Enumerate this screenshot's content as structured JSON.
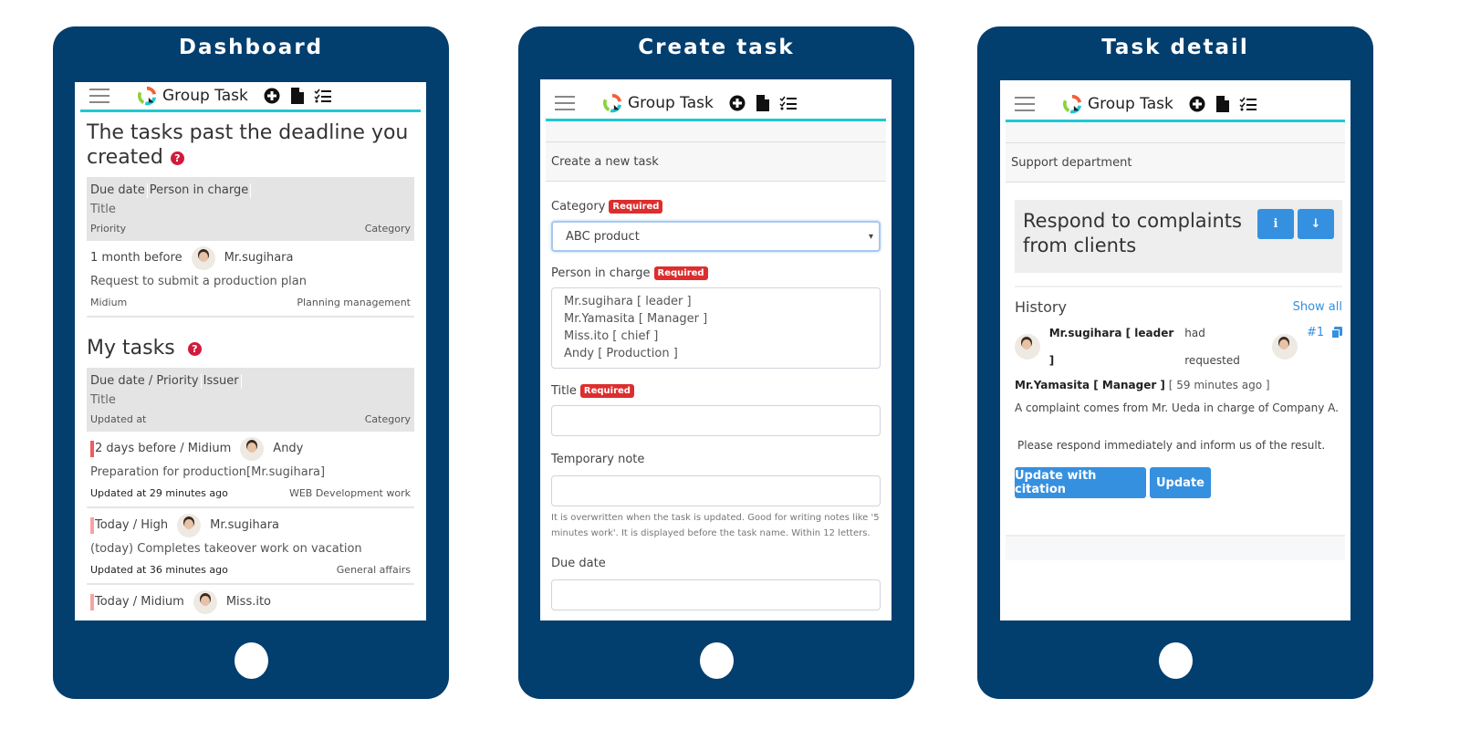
{
  "app": {
    "brand": "Group Task",
    "icons": [
      "menu-icon",
      "logo-icon",
      "plus-circle-icon",
      "file-icon",
      "checklist-icon"
    ],
    "accent_color": "#1fc8d2",
    "device_color": "#023e6e"
  },
  "screens": {
    "dashboard": {
      "caption": "Dashboard",
      "section1": {
        "title": "The tasks past the deadline you created",
        "help_icon": "?",
        "header": {
          "col1": "Due date",
          "col2": "Person in charge",
          "title": "Title",
          "left3": "Priority",
          "right3": "Category"
        },
        "rows": [
          {
            "due": "1 month before",
            "person": "Mr.sugihara",
            "title": "Request to submit a production plan",
            "priority": "Midium",
            "category": "Planning management"
          }
        ]
      },
      "section2": {
        "title": "My tasks",
        "help_icon": "?",
        "header": {
          "col1": "Due date / Priority",
          "col2": "Issuer",
          "title": "Title",
          "left3": "Updated at",
          "right3": "Category"
        },
        "rows": [
          {
            "due": "2 days before / Midium",
            "person": "Andy",
            "title": "Preparation for production[Mr.sugihara]",
            "updated": "Updated at 29 minutes ago",
            "category": "WEB Development work"
          },
          {
            "due": "Today / High",
            "person": "Mr.sugihara",
            "title": "(today) Completes takeover work on vacation",
            "updated": "Updated at 36 minutes ago",
            "category": "General affairs"
          },
          {
            "due": "Today / Midium",
            "person": "Miss.ito"
          }
        ]
      }
    },
    "create_task": {
      "caption": "Create task",
      "subtitle": "Create a new task",
      "required_label": "Required",
      "category": {
        "label": "Category",
        "value": "ABC product",
        "arrow": "▾"
      },
      "person": {
        "label": "Person in charge",
        "options": [
          "Mr.sugihara [ leader ]",
          "Mr.Yamasita [ Manager ]",
          "Miss.ito [ chief ]",
          "Andy [ Production ]"
        ]
      },
      "title": {
        "label": "Title",
        "value": ""
      },
      "note": {
        "label": "Temporary note",
        "value": "",
        "help": "It is overwritten when the task is updated. Good for writing notes like '5 minutes work'. It is displayed before the task name. Within 12 letters."
      },
      "due": {
        "label": "Due date",
        "value": ""
      }
    },
    "task_detail": {
      "caption": "Task detail",
      "department": "Support department",
      "task_title": "Respond to complaints from clients",
      "info_icon": "i",
      "down_icon": "↓",
      "history": {
        "label": "History",
        "show_all": "Show all",
        "entry": {
          "from": "Mr.sugihara [ leader ]",
          "verb": "had requested",
          "number": "#1",
          "to": "Mr.Yamasita [ Manager ]",
          "time": "[ 59 minutes ago ]",
          "body1": "A complaint comes from Mr. Ueda in charge of Company A.",
          "body2": "Please respond immediately and inform us of the result."
        }
      },
      "buttons": {
        "update_citation": "Update with citation",
        "update": "Update"
      }
    }
  }
}
